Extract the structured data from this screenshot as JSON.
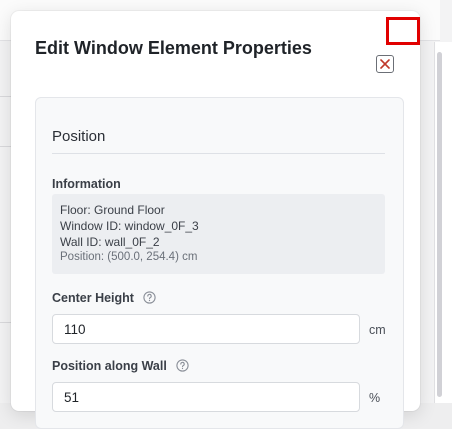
{
  "modal": {
    "title": "Edit Window Element Properties",
    "close_icon": "close-icon"
  },
  "section": {
    "title": "Position",
    "information": {
      "label": "Information",
      "floor": "Floor: Ground Floor",
      "window_id": "Window ID: window_0F_3",
      "wall_id": "Wall ID: wall_0F_2",
      "position": "Position: (500.0, 254.4) cm"
    },
    "center_height": {
      "label": "Center Height",
      "value": "110",
      "unit": "cm",
      "help_icon": "question-circle-icon"
    },
    "position_along_wall": {
      "label": "Position along Wall",
      "value": "51",
      "unit": "%",
      "help_icon": "question-circle-icon"
    }
  },
  "colors": {
    "highlight_box": "#e10000",
    "close_icon": "#c0392b"
  }
}
